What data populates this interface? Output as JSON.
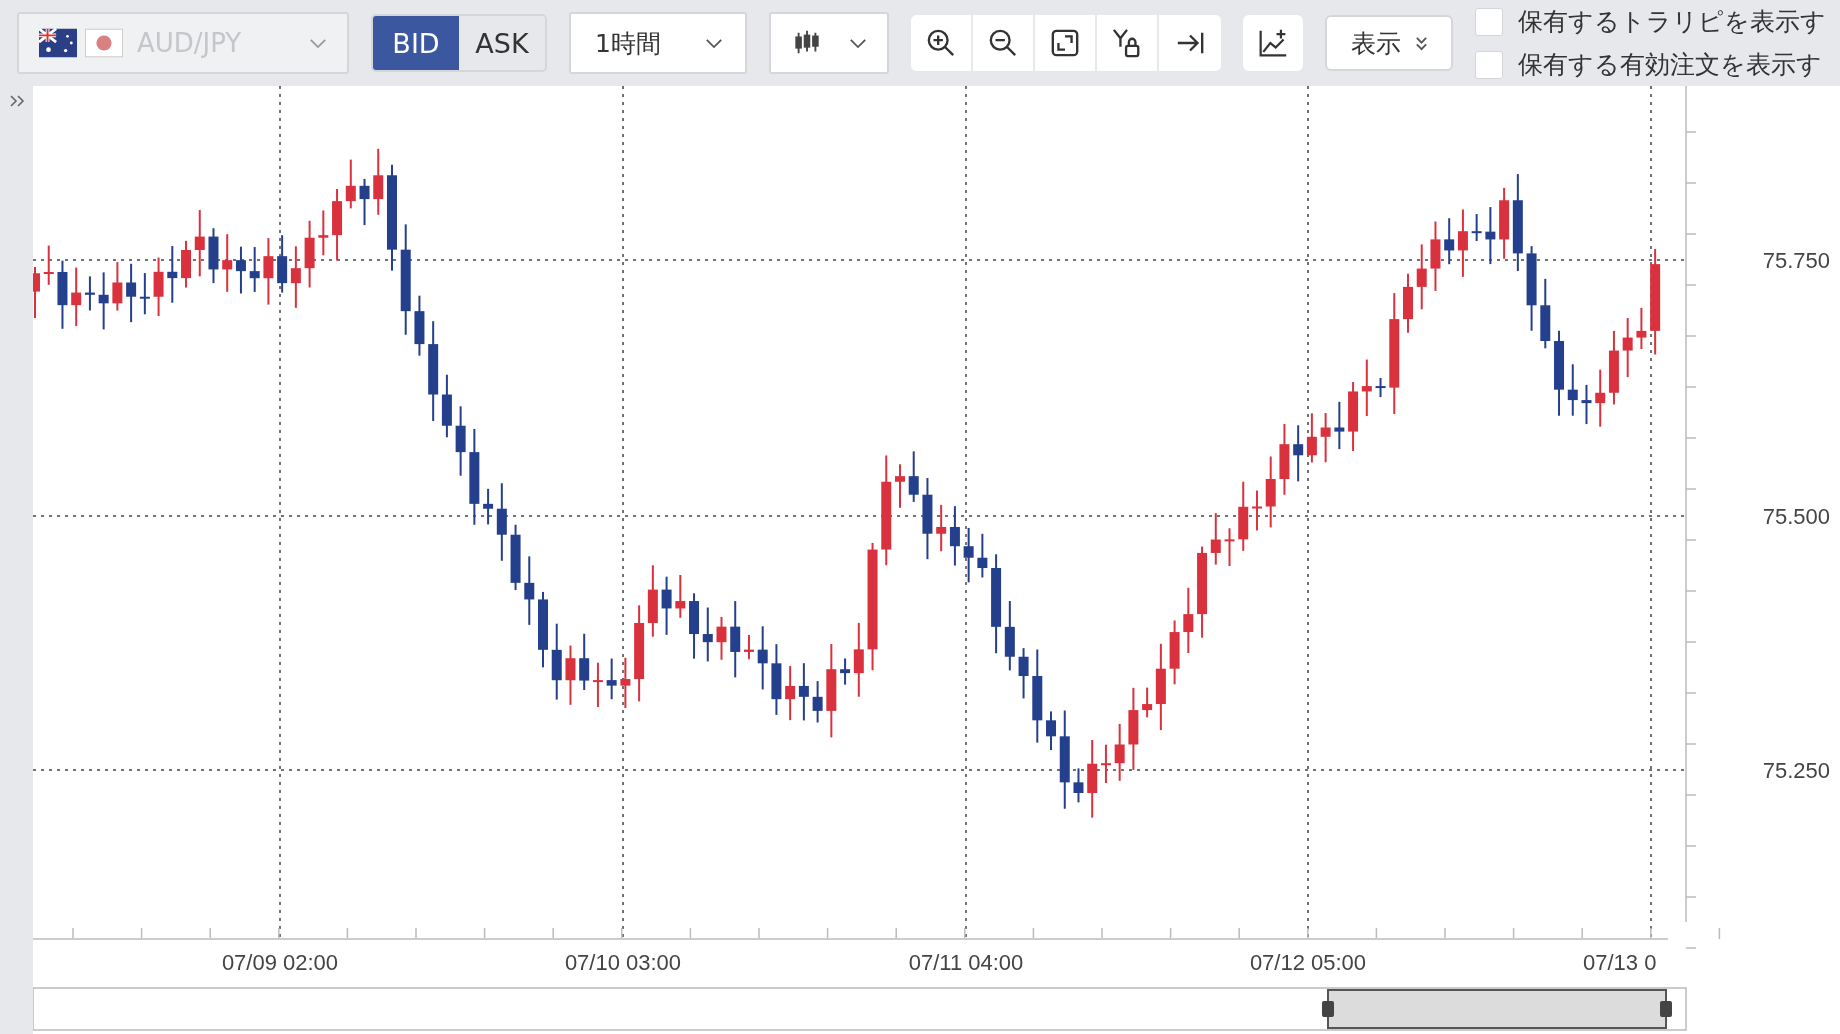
{
  "toolbar": {
    "symbol": {
      "label": "AUD/JPY",
      "disabled": true
    },
    "price_side": [
      {
        "label": "BID",
        "selected": true
      },
      {
        "label": "ASK",
        "selected": false
      }
    ],
    "timeframe": {
      "label": "1時間"
    },
    "display_button": {
      "label": "表示"
    },
    "checkboxes": [
      {
        "label": "保有するトラリピを表示す",
        "checked": false
      },
      {
        "label": "保有する有効注文を表示す",
        "checked": false
      }
    ]
  },
  "chart": {
    "y_labels": [
      "75.750",
      "75.500",
      "75.250"
    ],
    "x_labels": [
      "07/09 02:00",
      "07/10 03:00",
      "07/11 04:00",
      "07/12 05:00",
      "07/13 0"
    ]
  }
}
